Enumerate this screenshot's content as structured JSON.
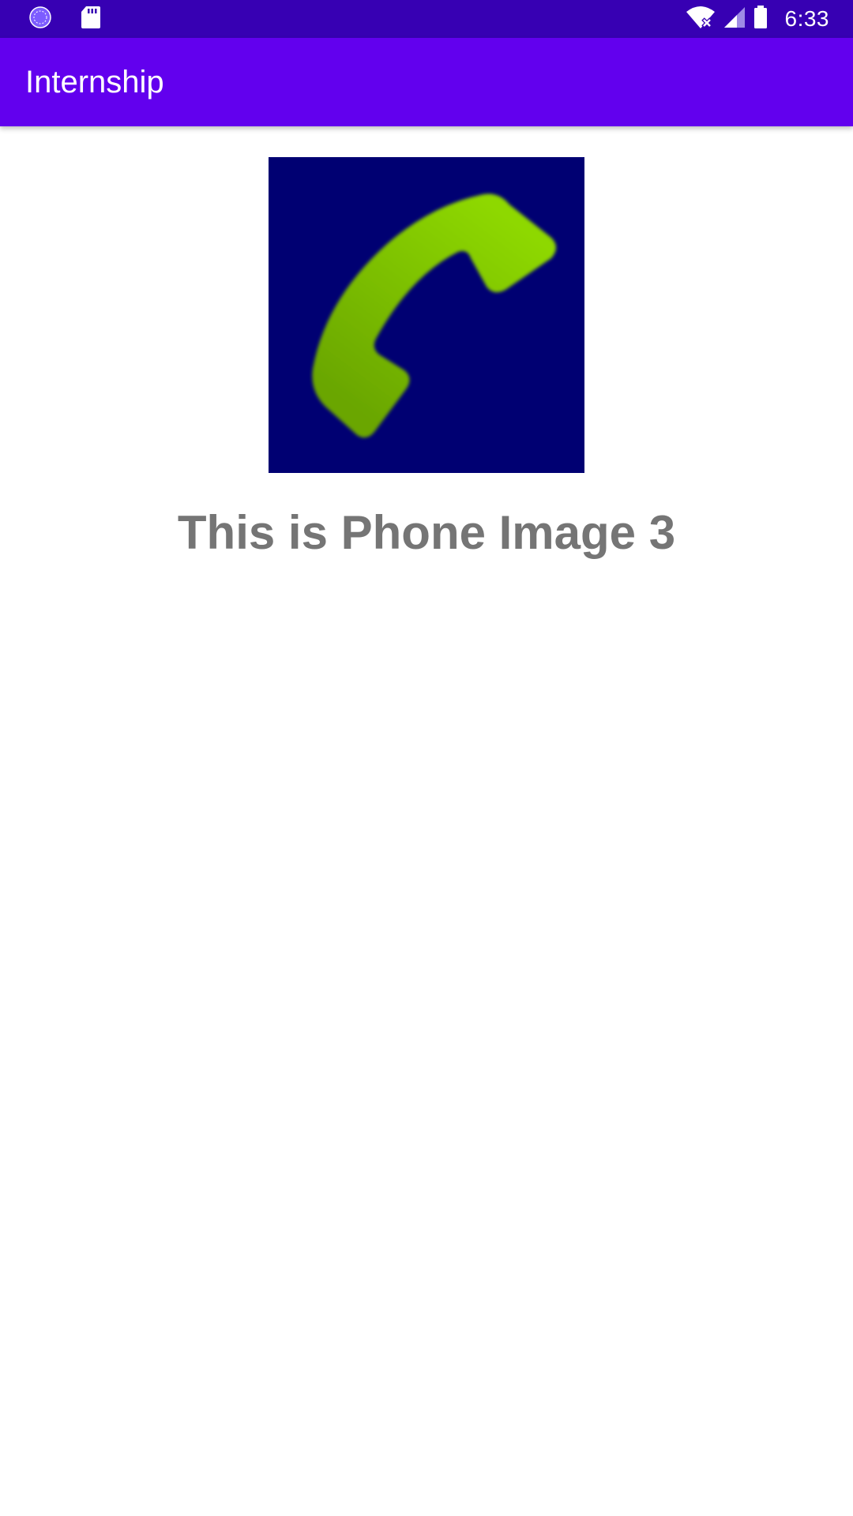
{
  "status_bar": {
    "time": "6:33",
    "icons": [
      "sync-icon",
      "sd-card-icon",
      "wifi-icon",
      "cell-signal-icon",
      "battery-icon"
    ],
    "color": "#3700b3"
  },
  "app_bar": {
    "title": "Internship",
    "color": "#6200ee"
  },
  "content": {
    "image": {
      "icon": "phone-handset-icon",
      "background": "#000072",
      "handset_color": "#8ed800"
    },
    "caption": "This is Phone Image 3"
  }
}
